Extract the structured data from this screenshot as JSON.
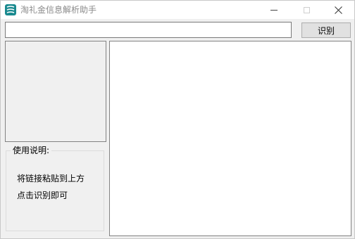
{
  "window": {
    "title": "淘礼金信息解析助手",
    "icon": "app-logo-icon"
  },
  "titlebar": {
    "minimize_icon": "minimize-icon",
    "maximize_icon": "maximize-icon",
    "close_icon": "close-icon"
  },
  "link_input": {
    "value": "",
    "placeholder": ""
  },
  "recognize_button": {
    "label": "识别"
  },
  "instructions": {
    "title": "使用说明:",
    "lines": [
      "将链接粘贴到上方",
      "点击识别即可"
    ]
  },
  "result": {
    "text": ""
  },
  "colors": {
    "background": "#f0f0f0",
    "titlebar": "#ffffff",
    "icon_accent": "#1a8a8f",
    "border": "#828282"
  }
}
